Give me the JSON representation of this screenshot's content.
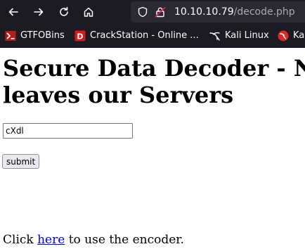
{
  "browser": {
    "url_host": "10.10.10.79",
    "url_path": "/decode.php",
    "bookmarks": [
      {
        "label": "GTFOBins",
        "icon": "gtfobins-icon"
      },
      {
        "label": "CrackStation - Online ...",
        "icon": "crackstation-icon"
      },
      {
        "label": "Kali Linux",
        "icon": "kali-linux-icon"
      },
      {
        "label": "Kal",
        "icon": "kali-tools-icon"
      }
    ]
  },
  "page": {
    "title": "Secure Data Decoder - No data leaves our Servers",
    "input_value": "cXdl",
    "submit_label": "submit",
    "encoder_prefix": "Click ",
    "encoder_link": "here",
    "encoder_suffix": " to use the encoder."
  },
  "colors": {
    "chrome_bg": "#1c1b22",
    "urlbar_bg": "#2b2a33",
    "link": "#0000ee"
  }
}
